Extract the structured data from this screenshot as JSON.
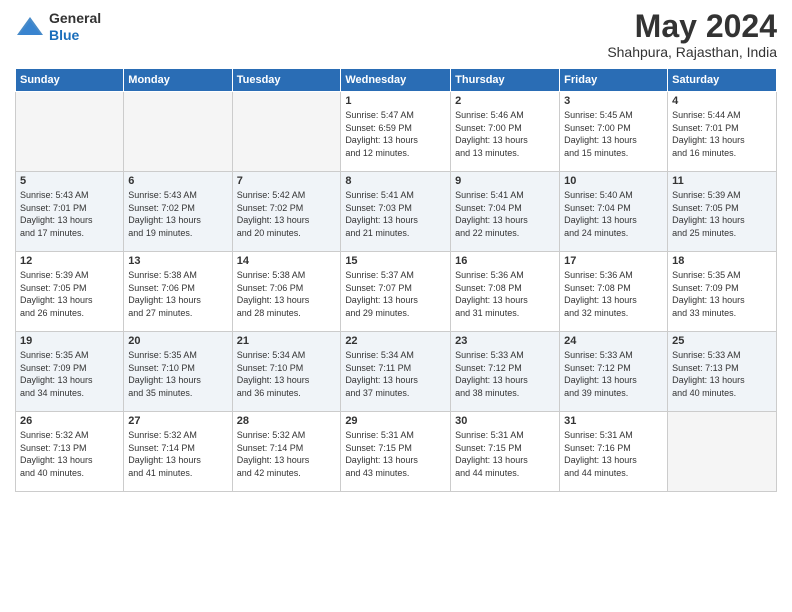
{
  "header": {
    "logo_general": "General",
    "logo_blue": "Blue",
    "month_year": "May 2024",
    "location": "Shahpura, Rajasthan, India"
  },
  "days_of_week": [
    "Sunday",
    "Monday",
    "Tuesday",
    "Wednesday",
    "Thursday",
    "Friday",
    "Saturday"
  ],
  "weeks": [
    {
      "shaded": false,
      "days": [
        {
          "number": "",
          "info": ""
        },
        {
          "number": "",
          "info": ""
        },
        {
          "number": "",
          "info": ""
        },
        {
          "number": "1",
          "info": "Sunrise: 5:47 AM\nSunset: 6:59 PM\nDaylight: 13 hours\nand 12 minutes."
        },
        {
          "number": "2",
          "info": "Sunrise: 5:46 AM\nSunset: 7:00 PM\nDaylight: 13 hours\nand 13 minutes."
        },
        {
          "number": "3",
          "info": "Sunrise: 5:45 AM\nSunset: 7:00 PM\nDaylight: 13 hours\nand 15 minutes."
        },
        {
          "number": "4",
          "info": "Sunrise: 5:44 AM\nSunset: 7:01 PM\nDaylight: 13 hours\nand 16 minutes."
        }
      ]
    },
    {
      "shaded": true,
      "days": [
        {
          "number": "5",
          "info": "Sunrise: 5:43 AM\nSunset: 7:01 PM\nDaylight: 13 hours\nand 17 minutes."
        },
        {
          "number": "6",
          "info": "Sunrise: 5:43 AM\nSunset: 7:02 PM\nDaylight: 13 hours\nand 19 minutes."
        },
        {
          "number": "7",
          "info": "Sunrise: 5:42 AM\nSunset: 7:02 PM\nDaylight: 13 hours\nand 20 minutes."
        },
        {
          "number": "8",
          "info": "Sunrise: 5:41 AM\nSunset: 7:03 PM\nDaylight: 13 hours\nand 21 minutes."
        },
        {
          "number": "9",
          "info": "Sunrise: 5:41 AM\nSunset: 7:04 PM\nDaylight: 13 hours\nand 22 minutes."
        },
        {
          "number": "10",
          "info": "Sunrise: 5:40 AM\nSunset: 7:04 PM\nDaylight: 13 hours\nand 24 minutes."
        },
        {
          "number": "11",
          "info": "Sunrise: 5:39 AM\nSunset: 7:05 PM\nDaylight: 13 hours\nand 25 minutes."
        }
      ]
    },
    {
      "shaded": false,
      "days": [
        {
          "number": "12",
          "info": "Sunrise: 5:39 AM\nSunset: 7:05 PM\nDaylight: 13 hours\nand 26 minutes."
        },
        {
          "number": "13",
          "info": "Sunrise: 5:38 AM\nSunset: 7:06 PM\nDaylight: 13 hours\nand 27 minutes."
        },
        {
          "number": "14",
          "info": "Sunrise: 5:38 AM\nSunset: 7:06 PM\nDaylight: 13 hours\nand 28 minutes."
        },
        {
          "number": "15",
          "info": "Sunrise: 5:37 AM\nSunset: 7:07 PM\nDaylight: 13 hours\nand 29 minutes."
        },
        {
          "number": "16",
          "info": "Sunrise: 5:36 AM\nSunset: 7:08 PM\nDaylight: 13 hours\nand 31 minutes."
        },
        {
          "number": "17",
          "info": "Sunrise: 5:36 AM\nSunset: 7:08 PM\nDaylight: 13 hours\nand 32 minutes."
        },
        {
          "number": "18",
          "info": "Sunrise: 5:35 AM\nSunset: 7:09 PM\nDaylight: 13 hours\nand 33 minutes."
        }
      ]
    },
    {
      "shaded": true,
      "days": [
        {
          "number": "19",
          "info": "Sunrise: 5:35 AM\nSunset: 7:09 PM\nDaylight: 13 hours\nand 34 minutes."
        },
        {
          "number": "20",
          "info": "Sunrise: 5:35 AM\nSunset: 7:10 PM\nDaylight: 13 hours\nand 35 minutes."
        },
        {
          "number": "21",
          "info": "Sunrise: 5:34 AM\nSunset: 7:10 PM\nDaylight: 13 hours\nand 36 minutes."
        },
        {
          "number": "22",
          "info": "Sunrise: 5:34 AM\nSunset: 7:11 PM\nDaylight: 13 hours\nand 37 minutes."
        },
        {
          "number": "23",
          "info": "Sunrise: 5:33 AM\nSunset: 7:12 PM\nDaylight: 13 hours\nand 38 minutes."
        },
        {
          "number": "24",
          "info": "Sunrise: 5:33 AM\nSunset: 7:12 PM\nDaylight: 13 hours\nand 39 minutes."
        },
        {
          "number": "25",
          "info": "Sunrise: 5:33 AM\nSunset: 7:13 PM\nDaylight: 13 hours\nand 40 minutes."
        }
      ]
    },
    {
      "shaded": false,
      "days": [
        {
          "number": "26",
          "info": "Sunrise: 5:32 AM\nSunset: 7:13 PM\nDaylight: 13 hours\nand 40 minutes."
        },
        {
          "number": "27",
          "info": "Sunrise: 5:32 AM\nSunset: 7:14 PM\nDaylight: 13 hours\nand 41 minutes."
        },
        {
          "number": "28",
          "info": "Sunrise: 5:32 AM\nSunset: 7:14 PM\nDaylight: 13 hours\nand 42 minutes."
        },
        {
          "number": "29",
          "info": "Sunrise: 5:31 AM\nSunset: 7:15 PM\nDaylight: 13 hours\nand 43 minutes."
        },
        {
          "number": "30",
          "info": "Sunrise: 5:31 AM\nSunset: 7:15 PM\nDaylight: 13 hours\nand 44 minutes."
        },
        {
          "number": "31",
          "info": "Sunrise: 5:31 AM\nSunset: 7:16 PM\nDaylight: 13 hours\nand 44 minutes."
        },
        {
          "number": "",
          "info": ""
        }
      ]
    }
  ]
}
